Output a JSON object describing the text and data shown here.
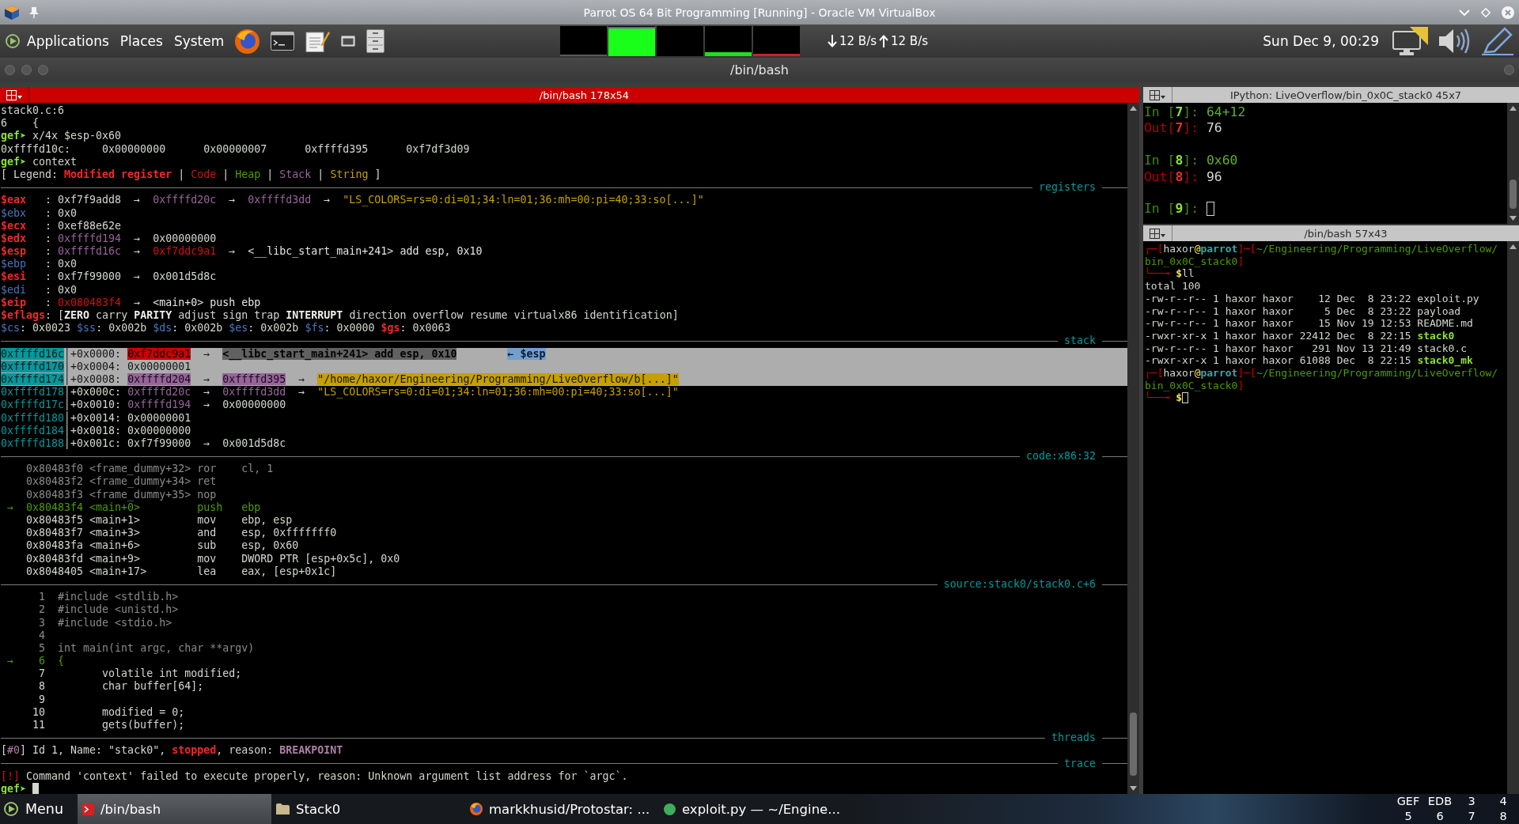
{
  "window": {
    "title": "Parrot OS 64 Bit Programming [Running] - Oracle VM VirtualBox"
  },
  "top_panel": {
    "menus": [
      "Applications",
      "Places",
      "System"
    ],
    "network": {
      "down": "12 B/s",
      "up": "12 B/s"
    },
    "clock": "Sun Dec 9, 00:29"
  },
  "terminal_window": {
    "title": "/bin/bash",
    "panes": [
      {
        "title": "/bin/bash 178x54",
        "focused": true,
        "lines": [
          {
            "kind": "text",
            "parts": [
              {
                "text": "stack0.c:6",
                "kind": "plain"
              }
            ]
          },
          {
            "kind": "text",
            "parts": [
              {
                "text": "6    {",
                "kind": "plain"
              }
            ]
          },
          {
            "kind": "text",
            "parts": [
              {
                "text": "gef➤",
                "kind": "prompt"
              },
              {
                "text": " x/4x $esp-0x60",
                "kind": "plain"
              }
            ]
          },
          {
            "kind": "text",
            "parts": [
              {
                "text": "0xffffd10c:     0x00000000      0x00000007      0xffffd395      0xf7df3d09",
                "kind": "plain"
              }
            ]
          },
          {
            "kind": "text",
            "parts": [
              {
                "text": "gef➤",
                "kind": "prompt"
              },
              {
                "text": " context",
                "kind": "plain"
              }
            ]
          },
          {
            "kind": "text",
            "parts": [
              {
                "text": "[ Legend: ",
                "kind": "plain"
              },
              {
                "text": "Modified register",
                "kind": "modified"
              },
              {
                "text": " | ",
                "kind": "plain"
              },
              {
                "text": "Code",
                "kind": "code"
              },
              {
                "text": " | ",
                "kind": "plain"
              },
              {
                "text": "Heap",
                "kind": "heap"
              },
              {
                "text": " | ",
                "kind": "plain"
              },
              {
                "text": "Stack",
                "kind": "stack"
              },
              {
                "text": " | ",
                "kind": "plain"
              },
              {
                "text": "String",
                "kind": "string"
              },
              {
                "text": " ]",
                "kind": "plain"
              }
            ]
          },
          {
            "kind": "rule",
            "label": "registers"
          },
          {
            "kind": "text",
            "parts": [
              {
                "text": "$eax",
                "kind": "modified"
              },
              {
                "text": "   : 0xf7f9add8  →  ",
                "kind": "plain"
              },
              {
                "text": "0xffffd20c",
                "kind": "stack"
              },
              {
                "text": "  →  ",
                "kind": "plain"
              },
              {
                "text": "0xffffd3dd",
                "kind": "stack"
              },
              {
                "text": "  →  ",
                "kind": "plain"
              },
              {
                "text": "\"LS_COLORS=rs=0:di=01;34:ln=01;36:mh=00:pi=40;33:so[...]\"",
                "kind": "string"
              }
            ]
          },
          {
            "kind": "text",
            "parts": [
              {
                "text": "$ebx",
                "kind": "reg"
              },
              {
                "text": "   : 0x0",
                "kind": "plain"
              }
            ]
          },
          {
            "kind": "text",
            "parts": [
              {
                "text": "$ecx",
                "kind": "modified"
              },
              {
                "text": "   : 0xef88e62e",
                "kind": "plain"
              }
            ]
          },
          {
            "kind": "text",
            "parts": [
              {
                "text": "$edx",
                "kind": "modified"
              },
              {
                "text": "   : ",
                "kind": "plain"
              },
              {
                "text": "0xffffd194",
                "kind": "stack"
              },
              {
                "text": "  →  0x00000000",
                "kind": "plain"
              }
            ]
          },
          {
            "kind": "text",
            "parts": [
              {
                "text": "$esp",
                "kind": "modified"
              },
              {
                "text": "   : ",
                "kind": "plain"
              },
              {
                "text": "0xffffd16c",
                "kind": "stack"
              },
              {
                "text": "  →  ",
                "kind": "plain"
              },
              {
                "text": "0xf7ddc9a1",
                "kind": "code"
              },
              {
                "text": "  →  ",
                "kind": "plain"
              },
              {
                "text": "<__libc_start_main+241> add esp, 0x10",
                "kind": "symbol"
              }
            ]
          },
          {
            "kind": "text",
            "parts": [
              {
                "text": "$ebp",
                "kind": "reg"
              },
              {
                "text": "   : 0x0",
                "kind": "plain"
              }
            ]
          },
          {
            "kind": "text",
            "parts": [
              {
                "text": "$esi",
                "kind": "modified"
              },
              {
                "text": "   : 0xf7f99000  →  0x001d5d8c",
                "kind": "plain"
              }
            ]
          },
          {
            "kind": "text",
            "parts": [
              {
                "text": "$edi",
                "kind": "reg"
              },
              {
                "text": "   : 0x0",
                "kind": "plain"
              }
            ]
          },
          {
            "kind": "text",
            "parts": [
              {
                "text": "$eip",
                "kind": "modified"
              },
              {
                "text": "   : ",
                "kind": "plain"
              },
              {
                "text": "0x080483f4",
                "kind": "code"
              },
              {
                "text": "  →  ",
                "kind": "plain"
              },
              {
                "text": "<main+0> push ebp",
                "kind": "symbol"
              }
            ]
          },
          {
            "kind": "text",
            "parts": [
              {
                "text": "$eflags",
                "kind": "modified"
              },
              {
                "text": ": [",
                "kind": "plain"
              },
              {
                "text": "ZERO",
                "kind": "bold"
              },
              {
                "text": " carry ",
                "kind": "plain"
              },
              {
                "text": "PARITY",
                "kind": "bold"
              },
              {
                "text": " adjust sign trap ",
                "kind": "plain"
              },
              {
                "text": "INTERRUPT",
                "kind": "bold"
              },
              {
                "text": " direction overflow resume virtualx86 identification]",
                "kind": "plain"
              }
            ]
          },
          {
            "kind": "text",
            "parts": [
              {
                "text": "$cs",
                "kind": "reg"
              },
              {
                "text": ": 0x0023 ",
                "kind": "plain"
              },
              {
                "text": "$ss",
                "kind": "reg"
              },
              {
                "text": ": 0x002b ",
                "kind": "plain"
              },
              {
                "text": "$ds",
                "kind": "reg"
              },
              {
                "text": ": 0x002b ",
                "kind": "plain"
              },
              {
                "text": "$es",
                "kind": "reg"
              },
              {
                "text": ": 0x002b ",
                "kind": "plain"
              },
              {
                "text": "$fs",
                "kind": "reg"
              },
              {
                "text": ": 0x0000 ",
                "kind": "plain"
              },
              {
                "text": "$gs",
                "kind": "modified"
              },
              {
                "text": ": 0x0063",
                "kind": "plain"
              }
            ]
          },
          {
            "kind": "rule",
            "label": "stack"
          },
          {
            "kind": "row",
            "selected": true,
            "parts": [
              {
                "text": "0xffffd16c",
                "kind": "addr"
              },
              {
                "text": "│+0x0000: ",
                "kind": "plain"
              },
              {
                "text": "0xf7ddc9a1",
                "kind": "code"
              },
              {
                "text": "  →  ",
                "kind": "plain"
              },
              {
                "text": "<__libc_start_main+241> add esp, 0x10",
                "kind": "symbol"
              },
              {
                "text": "        ← $esp",
                "kind": "pointer"
              }
            ]
          },
          {
            "kind": "row",
            "selected": true,
            "parts": [
              {
                "text": "0xffffd170",
                "kind": "addr"
              },
              {
                "text": "│+0x0004: 0x00000001",
                "kind": "plain"
              }
            ]
          },
          {
            "kind": "row",
            "selected": true,
            "parts": [
              {
                "text": "0xffffd174",
                "kind": "addr"
              },
              {
                "text": "│+0x0008: ",
                "kind": "plain"
              },
              {
                "text": "0xffffd204",
                "kind": "stack"
              },
              {
                "text": "  →  ",
                "kind": "plain"
              },
              {
                "text": "0xffffd395",
                "kind": "stack"
              },
              {
                "text": "  →  ",
                "kind": "plain"
              },
              {
                "text": "\"/home/haxor/Engineering/Programming/LiveOverflow/b[...]\"",
                "kind": "string"
              }
            ]
          },
          {
            "kind": "row",
            "selected": false,
            "parts": [
              {
                "text": "0xffffd178",
                "kind": "addr"
              },
              {
                "text": "│+0x000c: ",
                "kind": "plain"
              },
              {
                "text": "0xffffd20c",
                "kind": "stack"
              },
              {
                "text": "  →  ",
                "kind": "plain"
              },
              {
                "text": "0xffffd3dd",
                "kind": "stack"
              },
              {
                "text": "  →  ",
                "kind": "plain"
              },
              {
                "text": "\"LS_COLORS=rs=0:di=01;34:ln=01;36:mh=00:pi=40;33:so[...]\"",
                "kind": "string"
              }
            ]
          },
          {
            "kind": "row",
            "selected": false,
            "parts": [
              {
                "text": "0xffffd17c",
                "kind": "addr"
              },
              {
                "text": "│+0x0010: ",
                "kind": "plain"
              },
              {
                "text": "0xffffd194",
                "kind": "stack"
              },
              {
                "text": "  →  0x00000000",
                "kind": "plain"
              }
            ]
          },
          {
            "kind": "row",
            "selected": false,
            "parts": [
              {
                "text": "0xffffd180",
                "kind": "addr"
              },
              {
                "text": "│+0x0014: 0x00000001",
                "kind": "plain"
              }
            ]
          },
          {
            "kind": "row",
            "selected": false,
            "parts": [
              {
                "text": "0xffffd184",
                "kind": "addr"
              },
              {
                "text": "│+0x0018: 0x00000000",
                "kind": "plain"
              }
            ]
          },
          {
            "kind": "row",
            "selected": false,
            "parts": [
              {
                "text": "0xffffd188",
                "kind": "addr"
              },
              {
                "text": "│+0x001c: 0xf7f99000  →  0x001d5d8c",
                "kind": "plain"
              }
            ]
          },
          {
            "kind": "rule",
            "label": "code:x86:32"
          },
          {
            "kind": "text",
            "parts": [
              {
                "text": "    0x80483f0 <frame_dummy+32> ror    cl, 1",
                "kind": "dim"
              }
            ]
          },
          {
            "kind": "text",
            "parts": [
              {
                "text": "    0x80483f2 <frame_dummy+34> ret",
                "kind": "dim"
              }
            ]
          },
          {
            "kind": "text",
            "parts": [
              {
                "text": "    0x80483f3 <frame_dummy+35> nop",
                "kind": "dim"
              }
            ]
          },
          {
            "kind": "text",
            "parts": [
              {
                "text": " →  0x80483f4 <main+0>         push   ebp",
                "kind": "current"
              }
            ]
          },
          {
            "kind": "text",
            "parts": [
              {
                "text": "    0x80483f5 <main+1>         mov    ebp, esp",
                "kind": "plain"
              }
            ]
          },
          {
            "kind": "text",
            "parts": [
              {
                "text": "    0x80483f7 <main+3>         and    esp, 0xfffffff0",
                "kind": "plain"
              }
            ]
          },
          {
            "kind": "text",
            "parts": [
              {
                "text": "    0x80483fa <main+6>         sub    esp, 0x60",
                "kind": "plain"
              }
            ]
          },
          {
            "kind": "text",
            "parts": [
              {
                "text": "    0x80483fd <main+9>         mov    DWORD PTR [esp+0x5c], 0x0",
                "kind": "plain"
              }
            ]
          },
          {
            "kind": "text",
            "parts": [
              {
                "text": "    0x8048405 <main+17>        lea    eax, [esp+0x1c]",
                "kind": "plain"
              }
            ]
          },
          {
            "kind": "rule",
            "label": "source:stack0/stack0.c+6"
          },
          {
            "kind": "text",
            "parts": [
              {
                "text": "      1  #include <stdlib.h>",
                "kind": "dim"
              }
            ]
          },
          {
            "kind": "text",
            "parts": [
              {
                "text": "      2  #include <unistd.h>",
                "kind": "dim"
              }
            ]
          },
          {
            "kind": "text",
            "parts": [
              {
                "text": "      3  #include <stdio.h>",
                "kind": "dim"
              }
            ]
          },
          {
            "kind": "text",
            "parts": [
              {
                "text": "      4",
                "kind": "dim"
              }
            ]
          },
          {
            "kind": "text",
            "parts": [
              {
                "text": "      5  int main(int argc, char **argv)",
                "kind": "dim"
              }
            ]
          },
          {
            "kind": "text",
            "parts": [
              {
                "text": " →    6  {",
                "kind": "current"
              }
            ]
          },
          {
            "kind": "text",
            "parts": [
              {
                "text": "      7         volatile int modified;",
                "kind": "plain"
              }
            ]
          },
          {
            "kind": "text",
            "parts": [
              {
                "text": "      8         char buffer[64];",
                "kind": "plain"
              }
            ]
          },
          {
            "kind": "text",
            "parts": [
              {
                "text": "      9",
                "kind": "plain"
              }
            ]
          },
          {
            "kind": "text",
            "parts": [
              {
                "text": "     10         modified = 0;",
                "kind": "plain"
              }
            ]
          },
          {
            "kind": "text",
            "parts": [
              {
                "text": "     11         gets(buffer);",
                "kind": "plain"
              }
            ]
          },
          {
            "kind": "rule",
            "label": "threads"
          },
          {
            "kind": "text",
            "parts": [
              {
                "text": "[",
                "kind": "plain"
              },
              {
                "text": "#0",
                "kind": "index"
              },
              {
                "text": "] Id 1, Name: \"stack0\", ",
                "kind": "plain"
              },
              {
                "text": "stopped",
                "kind": "alert"
              },
              {
                "text": ", reason: ",
                "kind": "plain"
              },
              {
                "text": "BREAKPOINT",
                "kind": "reason"
              }
            ]
          },
          {
            "kind": "rule",
            "label": "trace"
          },
          {
            "kind": "text",
            "parts": [
              {
                "text": "[!]",
                "kind": "error"
              },
              {
                "text": " Command 'context' failed to execute properly, reason: Unknown argument list address for `argc`.",
                "kind": "plain"
              }
            ]
          },
          {
            "kind": "text",
            "parts": [
              {
                "text": "gef➤",
                "kind": "prompt"
              },
              {
                "kind": "cursor"
              }
            ]
          }
        ]
      },
      {
        "title": "IPython: LiveOverflow/bin_0x0C_stack0 45x7",
        "focused": false,
        "lines": [
          {
            "kind": "text",
            "parts": [
              {
                "text": "In [",
                "kind": "inlabel"
              },
              {
                "text": "7",
                "kind": "innum"
              },
              {
                "text": "]: ",
                "kind": "inlabel"
              },
              {
                "text": "64+12",
                "kind": "incode"
              }
            ]
          },
          {
            "kind": "text",
            "parts": [
              {
                "text": "Out[",
                "kind": "outlabel"
              },
              {
                "text": "7",
                "kind": "outnum"
              },
              {
                "text": "]: ",
                "kind": "outlabel"
              },
              {
                "text": "76",
                "kind": "plain"
              }
            ]
          },
          {
            "kind": "blank"
          },
          {
            "kind": "text",
            "parts": [
              {
                "text": "In [",
                "kind": "inlabel"
              },
              {
                "text": "8",
                "kind": "innum"
              },
              {
                "text": "]: ",
                "kind": "inlabel"
              },
              {
                "text": "0x60",
                "kind": "incode"
              }
            ]
          },
          {
            "kind": "text",
            "parts": [
              {
                "text": "Out[",
                "kind": "outlabel"
              },
              {
                "text": "8",
                "kind": "outnum"
              },
              {
                "text": "]: ",
                "kind": "outlabel"
              },
              {
                "text": "96",
                "kind": "plain"
              }
            ]
          },
          {
            "kind": "blank"
          },
          {
            "kind": "text",
            "parts": [
              {
                "text": "In [",
                "kind": "inlabel"
              },
              {
                "text": "9",
                "kind": "innum"
              },
              {
                "text": "]:",
                "kind": "inlabel"
              },
              {
                "kind": "cursor"
              }
            ]
          }
        ]
      },
      {
        "title": "/bin/bash 57x43",
        "focused": false,
        "lines": [
          {
            "kind": "text",
            "parts": [
              {
                "text": "┌─[",
                "kind": "frame"
              },
              {
                "text": "haxor",
                "kind": "user"
              },
              {
                "text": "@",
                "kind": "at"
              },
              {
                "text": "parrot",
                "kind": "host"
              },
              {
                "text": "]─[",
                "kind": "frame"
              },
              {
                "text": "~/Engineering/Programming/LiveOverflow/bin_0x0C_stack0",
                "kind": "path"
              },
              {
                "text": "]",
                "kind": "frame"
              }
            ]
          },
          {
            "kind": "text",
            "parts": [
              {
                "text": "└──╼ ",
                "kind": "frame"
              },
              {
                "text": "$",
                "kind": "dollar"
              },
              {
                "text": "ll",
                "kind": "plain"
              }
            ]
          },
          {
            "kind": "text",
            "parts": [
              {
                "text": "total 100",
                "kind": "plain"
              }
            ]
          },
          {
            "kind": "text",
            "parts": [
              {
                "text": "-rw-r--r-- 1 haxor haxor    12 Dec  8 23:22 exploit.py",
                "kind": "plain"
              }
            ]
          },
          {
            "kind": "text",
            "parts": [
              {
                "text": "-rw-r--r-- 1 haxor haxor     5 Dec  8 23:22 payload",
                "kind": "plain"
              }
            ]
          },
          {
            "kind": "text",
            "parts": [
              {
                "text": "-rw-r--r-- 1 haxor haxor    15 Nov 19 12:53 README.md",
                "kind": "plain"
              }
            ]
          },
          {
            "kind": "text",
            "parts": [
              {
                "text": "-rwxr-xr-x 1 haxor haxor 22412 Dec  8 22:15 ",
                "kind": "plain"
              },
              {
                "text": "stack0",
                "kind": "exec"
              }
            ]
          },
          {
            "kind": "text",
            "parts": [
              {
                "text": "-rw-r--r-- 1 haxor haxor   291 Nov 13 21:49 stack0.c",
                "kind": "plain"
              }
            ]
          },
          {
            "kind": "text",
            "parts": [
              {
                "text": "-rwxr-xr-x 1 haxor haxor 61088 Dec  8 22:15 ",
                "kind": "plain"
              },
              {
                "text": "stack0_mk",
                "kind": "exec"
              }
            ]
          },
          {
            "kind": "text",
            "parts": [
              {
                "text": "┌─[",
                "kind": "frame"
              },
              {
                "text": "haxor",
                "kind": "user"
              },
              {
                "text": "@",
                "kind": "at"
              },
              {
                "text": "parrot",
                "kind": "host"
              },
              {
                "text": "]─[",
                "kind": "frame"
              },
              {
                "text": "~/Engineering/Programming/LiveOverflow/bin_0x0C_stack0",
                "kind": "path"
              },
              {
                "text": "]",
                "kind": "frame"
              }
            ]
          },
          {
            "kind": "text",
            "parts": [
              {
                "text": "└──╼ ",
                "kind": "frame"
              },
              {
                "text": "$",
                "kind": "dollar"
              },
              {
                "kind": "cursor"
              }
            ]
          }
        ]
      }
    ]
  },
  "taskbar": {
    "menu": "Menu",
    "tasks": [
      {
        "label": "/bin/bash",
        "selected": true
      },
      {
        "label": "Stack0",
        "selected": false
      },
      {
        "label": "markkhusid/Protostar: ...",
        "selected": false
      },
      {
        "label": "exploit.py — ~/Engine...",
        "selected": false
      }
    ],
    "workspaces": [
      "GEF",
      "EDB",
      "3",
      "4",
      "5",
      "6",
      "7",
      "8"
    ]
  }
}
